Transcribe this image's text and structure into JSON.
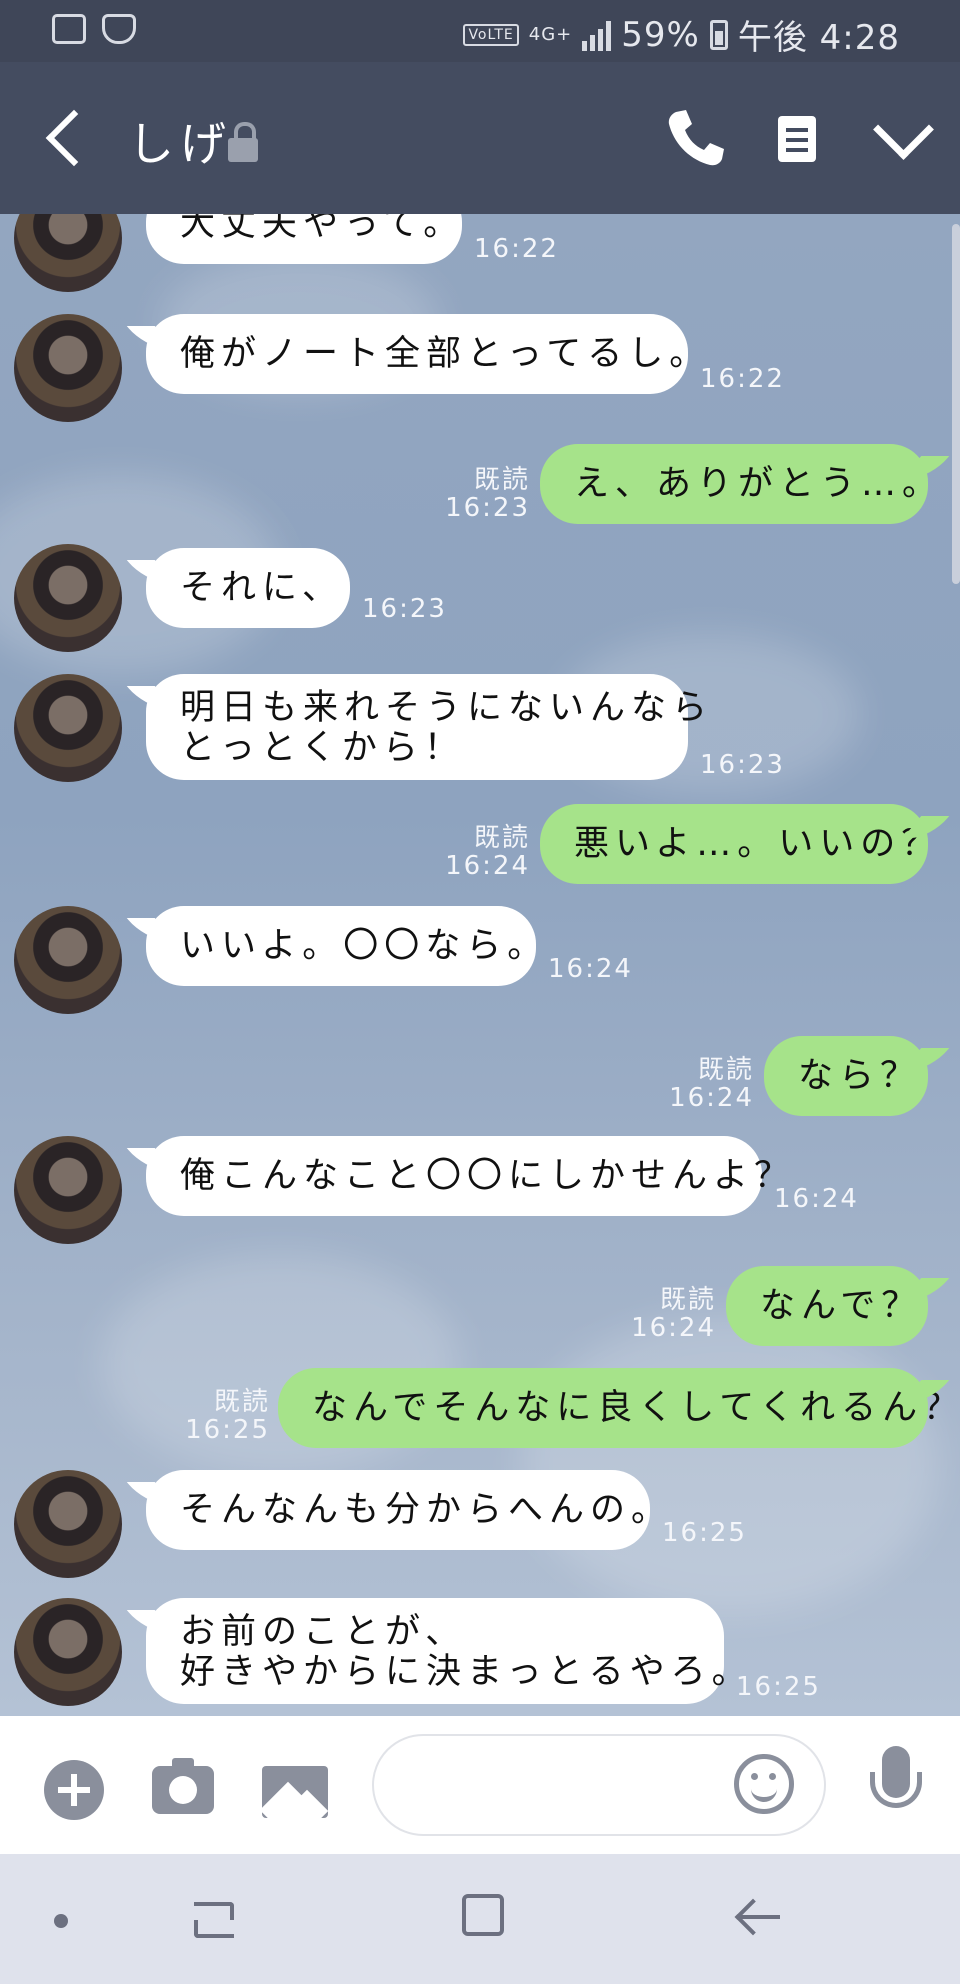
{
  "status_bar": {
    "battery": "59%",
    "time": "午後 4:28",
    "network": "4G+",
    "volte": "VoLTE"
  },
  "header": {
    "title": "しげ"
  },
  "messages": [
    {
      "side": "in",
      "text": "大丈夫やって。",
      "time": "16:22"
    },
    {
      "side": "in",
      "text": "俺がノート全部とってるし。",
      "time": "16:22"
    },
    {
      "side": "out",
      "text": "え、ありがとう…。",
      "read": "既読",
      "time": "16:23"
    },
    {
      "side": "in",
      "text": "それに、",
      "time": "16:23"
    },
    {
      "side": "in",
      "line1": "明日も来れそうにないんなら",
      "line2": "とっとくから！",
      "time": "16:23"
    },
    {
      "side": "out",
      "text": "悪いよ…。いいの？",
      "read": "既読",
      "time": "16:24"
    },
    {
      "side": "in",
      "text": "いいよ。〇〇なら。",
      "time": "16:24"
    },
    {
      "side": "out",
      "text": "なら？",
      "read": "既読",
      "time": "16:24"
    },
    {
      "side": "in",
      "text": "俺こんなこと〇〇にしかせんよ？",
      "time": "16:24"
    },
    {
      "side": "out",
      "text": "なんで？",
      "read": "既読",
      "time": "16:24"
    },
    {
      "side": "out",
      "text": "なんでそんなに良くしてくれるん？",
      "read": "既読",
      "time": "16:25"
    },
    {
      "side": "in",
      "text": "そんなんも分からへんの。",
      "time": "16:25"
    },
    {
      "side": "in",
      "line1": "お前のことが、",
      "line2": "好きやからに決まっとるやろ。",
      "time": "16:25"
    }
  ],
  "colors": {
    "header_bg": "#444c60",
    "outgoing_bubble": "#a6e38a",
    "incoming_bubble": "#ffffff",
    "chat_bg": "#8fa3bf"
  },
  "icons": [
    "back-icon",
    "lock-icon",
    "phone-icon",
    "memo-icon",
    "chevron-down-icon",
    "plus-icon",
    "camera-icon",
    "image-icon",
    "emoji-icon",
    "mic-icon"
  ]
}
